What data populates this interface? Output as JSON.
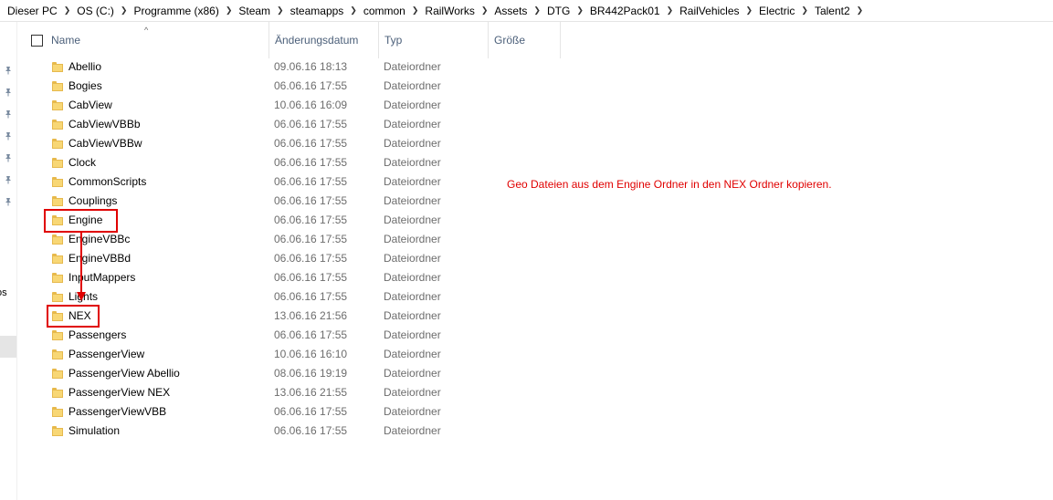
{
  "breadcrumb": {
    "items": [
      "Dieser PC",
      "OS (C:)",
      "Programme (x86)",
      "Steam",
      "steamapps",
      "common",
      "RailWorks",
      "Assets",
      "DTG",
      "BR442Pack01",
      "RailVehicles",
      "Electric",
      "Talent2"
    ]
  },
  "nav": {
    "stub_label": "os"
  },
  "columns": {
    "name": "Name",
    "date": "Änderungsdatum",
    "type": "Typ",
    "size": "Größe"
  },
  "files": [
    {
      "name": "Abellio",
      "date": "09.06.16 18:13",
      "type": "Dateiordner"
    },
    {
      "name": "Bogies",
      "date": "06.06.16 17:55",
      "type": "Dateiordner"
    },
    {
      "name": "CabView",
      "date": "10.06.16 16:09",
      "type": "Dateiordner"
    },
    {
      "name": "CabViewVBBb",
      "date": "06.06.16 17:55",
      "type": "Dateiordner"
    },
    {
      "name": "CabViewVBBw",
      "date": "06.06.16 17:55",
      "type": "Dateiordner"
    },
    {
      "name": "Clock",
      "date": "06.06.16 17:55",
      "type": "Dateiordner"
    },
    {
      "name": "CommonScripts",
      "date": "06.06.16 17:55",
      "type": "Dateiordner"
    },
    {
      "name": "Couplings",
      "date": "06.06.16 17:55",
      "type": "Dateiordner"
    },
    {
      "name": "Engine",
      "date": "06.06.16 17:55",
      "type": "Dateiordner"
    },
    {
      "name": "EngineVBBc",
      "date": "06.06.16 17:55",
      "type": "Dateiordner"
    },
    {
      "name": "EngineVBBd",
      "date": "06.06.16 17:55",
      "type": "Dateiordner"
    },
    {
      "name": "InputMappers",
      "date": "06.06.16 17:55",
      "type": "Dateiordner"
    },
    {
      "name": "Lights",
      "date": "06.06.16 17:55",
      "type": "Dateiordner"
    },
    {
      "name": "NEX",
      "date": "13.06.16 21:56",
      "type": "Dateiordner"
    },
    {
      "name": "Passengers",
      "date": "06.06.16 17:55",
      "type": "Dateiordner"
    },
    {
      "name": "PassengerView",
      "date": "10.06.16 16:10",
      "type": "Dateiordner"
    },
    {
      "name": "PassengerView Abellio",
      "date": "08.06.16 19:19",
      "type": "Dateiordner"
    },
    {
      "name": "PassengerView NEX",
      "date": "13.06.16 21:55",
      "type": "Dateiordner"
    },
    {
      "name": "PassengerViewVBB",
      "date": "06.06.16 17:55",
      "type": "Dateiordner"
    },
    {
      "name": "Simulation",
      "date": "06.06.16 17:55",
      "type": "Dateiordner"
    }
  ],
  "annotation": {
    "text": "Geo Dateien aus dem Engine Ordner in den NEX Ordner kopieren.",
    "color": "#e00000"
  },
  "icons": {
    "folder": "folder-icon",
    "pin": "pin-icon",
    "separator": "chevron-right-icon"
  }
}
